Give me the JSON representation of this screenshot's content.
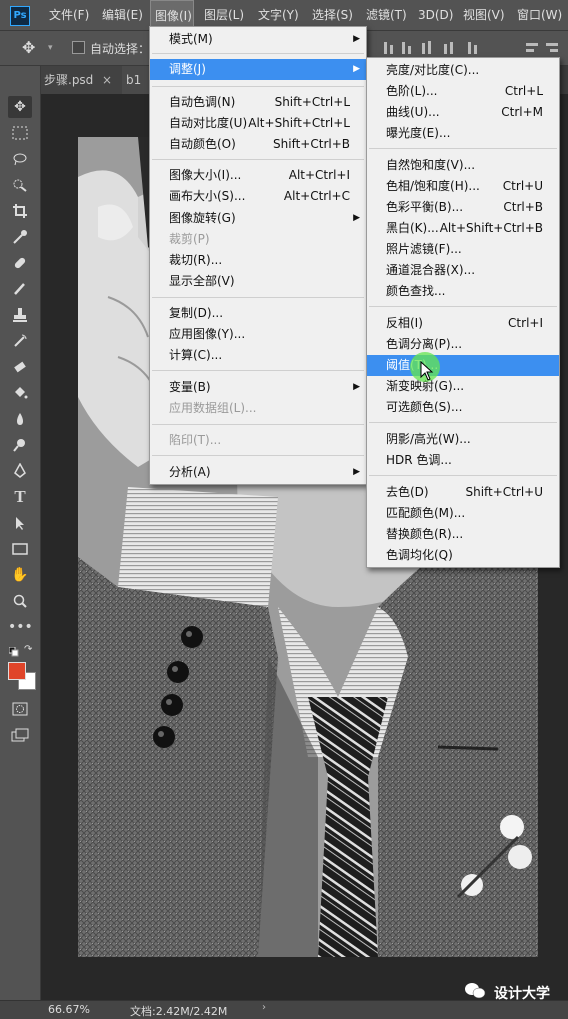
{
  "app": {
    "logo_text": "Ps",
    "accent": "#31a8ff"
  },
  "menubar": {
    "items": [
      "文件(F)",
      "编辑(E)",
      "图像(I)",
      "图层(L)",
      "文字(Y)",
      "选择(S)",
      "滤镜(T)",
      "3D(D)",
      "视图(V)",
      "窗口(W)"
    ],
    "active_index": 2
  },
  "options_bar": {
    "auto_select_label": "自动选择："
  },
  "tabs": [
    {
      "label": "步骤.psd"
    },
    {
      "label": "b1"
    }
  ],
  "status_bar": {
    "zoom": "66.67%",
    "doc": "文档:2.42M/2.42M"
  },
  "watermark": {
    "text": "设计大学"
  },
  "image_menu": {
    "items": [
      {
        "label": "模式(M)",
        "has_submenu": true
      },
      {
        "label": "调整(J)",
        "has_submenu": true,
        "highlighted": true
      },
      {
        "label": "自动色调(N)",
        "shortcut": "Shift+Ctrl+L"
      },
      {
        "label": "自动对比度(U)",
        "shortcut": "Alt+Shift+Ctrl+L"
      },
      {
        "label": "自动颜色(O)",
        "shortcut": "Shift+Ctrl+B"
      },
      {
        "label": "图像大小(I)...",
        "shortcut": "Alt+Ctrl+I"
      },
      {
        "label": "画布大小(S)...",
        "shortcut": "Alt+Ctrl+C"
      },
      {
        "label": "图像旋转(G)",
        "has_submenu": true
      },
      {
        "label": "裁剪(P)",
        "disabled": true
      },
      {
        "label": "裁切(R)..."
      },
      {
        "label": "显示全部(V)"
      },
      {
        "label": "复制(D)..."
      },
      {
        "label": "应用图像(Y)..."
      },
      {
        "label": "计算(C)..."
      },
      {
        "label": "变量(B)",
        "has_submenu": true
      },
      {
        "label": "应用数据组(L)...",
        "disabled": true
      },
      {
        "label": "陷印(T)...",
        "disabled": true
      },
      {
        "label": "分析(A)",
        "has_submenu": true
      }
    ]
  },
  "adjust_menu": {
    "items": [
      {
        "label": "亮度/对比度(C)..."
      },
      {
        "label": "色阶(L)...",
        "shortcut": "Ctrl+L"
      },
      {
        "label": "曲线(U)...",
        "shortcut": "Ctrl+M"
      },
      {
        "label": "曝光度(E)..."
      },
      {
        "label": "自然饱和度(V)..."
      },
      {
        "label": "色相/饱和度(H)...",
        "shortcut": "Ctrl+U"
      },
      {
        "label": "色彩平衡(B)...",
        "shortcut": "Ctrl+B"
      },
      {
        "label": "黑白(K)...",
        "shortcut": "Alt+Shift+Ctrl+B"
      },
      {
        "label": "照片滤镜(F)..."
      },
      {
        "label": "通道混合器(X)..."
      },
      {
        "label": "颜色查找..."
      },
      {
        "label": "反相(I)",
        "shortcut": "Ctrl+I"
      },
      {
        "label": "色调分离(P)..."
      },
      {
        "label": "阈值(T)...",
        "highlighted": true
      },
      {
        "label": "渐变映射(G)..."
      },
      {
        "label": "可选颜色(S)..."
      },
      {
        "label": "阴影/高光(W)..."
      },
      {
        "label": "HDR 色调..."
      },
      {
        "label": "去色(D)",
        "shortcut": "Shift+Ctrl+U"
      },
      {
        "label": "匹配颜色(M)..."
      },
      {
        "label": "替换颜色(R)..."
      },
      {
        "label": "色调均化(Q)"
      }
    ]
  },
  "colors": {
    "foreground": "#e0452a",
    "background": "#ffffff",
    "highlight": "#3c8ff0"
  }
}
